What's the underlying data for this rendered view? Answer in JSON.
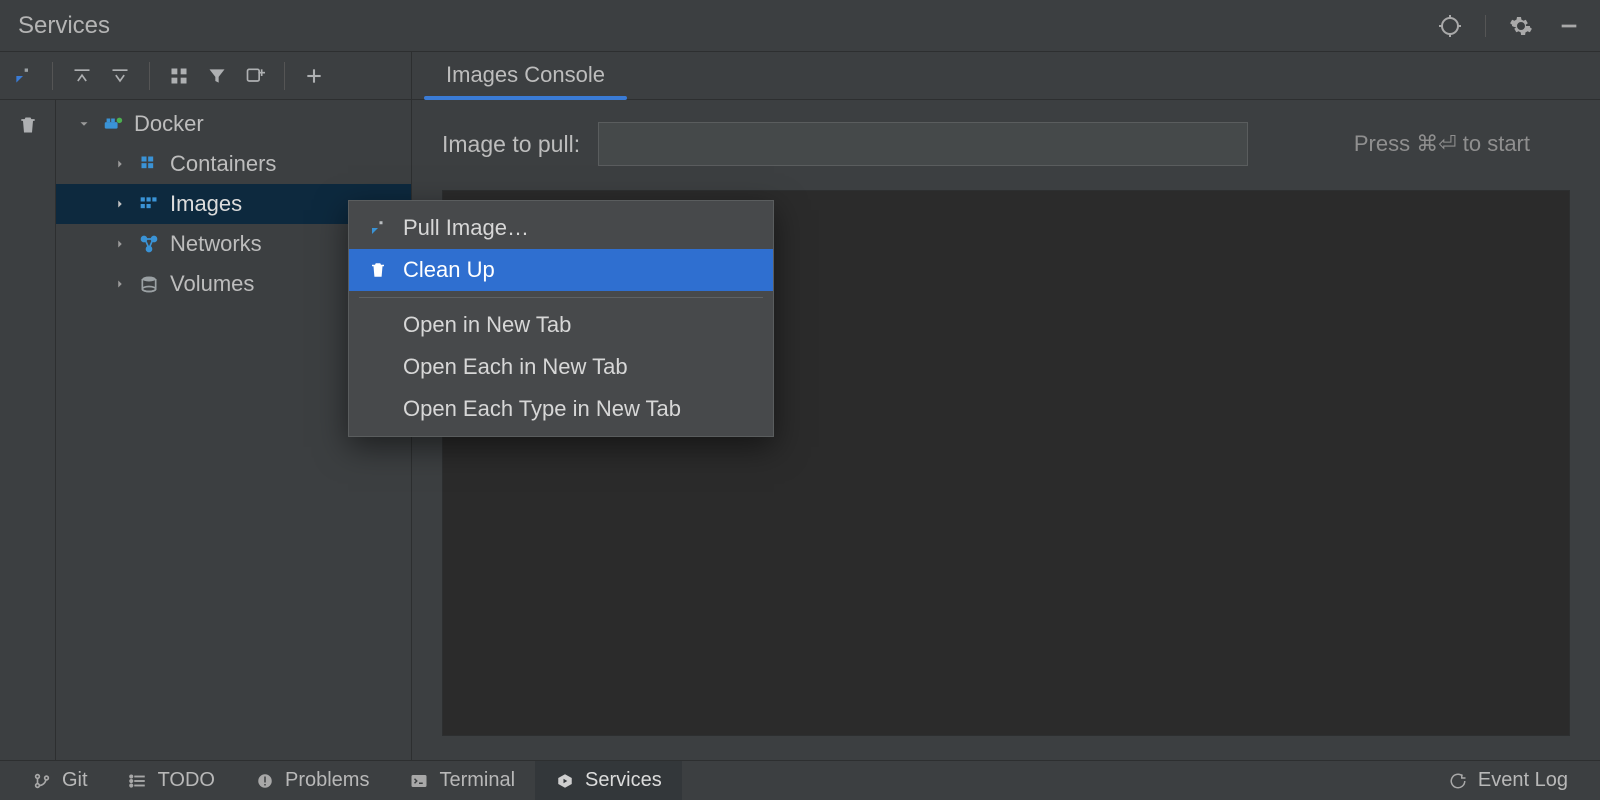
{
  "title": "Services",
  "toolbar": {},
  "tree": {
    "root": {
      "label": "Docker"
    },
    "children": [
      {
        "label": "Containers"
      },
      {
        "label": "Images"
      },
      {
        "label": "Networks"
      },
      {
        "label": "Volumes"
      }
    ]
  },
  "content": {
    "tab_label": "Images Console",
    "pull_label": "Image to pull:",
    "pull_value": "",
    "pull_hint": "Press ⌘⏎ to start"
  },
  "context_menu": {
    "items": [
      {
        "label": "Pull Image…"
      },
      {
        "label": "Clean Up"
      },
      {
        "label": "Open in New Tab"
      },
      {
        "label": "Open Each in New Tab"
      },
      {
        "label": "Open Each Type in New Tab"
      }
    ]
  },
  "footer": {
    "items": [
      {
        "label": "Git"
      },
      {
        "label": "TODO"
      },
      {
        "label": "Problems"
      },
      {
        "label": "Terminal"
      },
      {
        "label": "Services"
      }
    ],
    "event_log": "Event Log"
  }
}
